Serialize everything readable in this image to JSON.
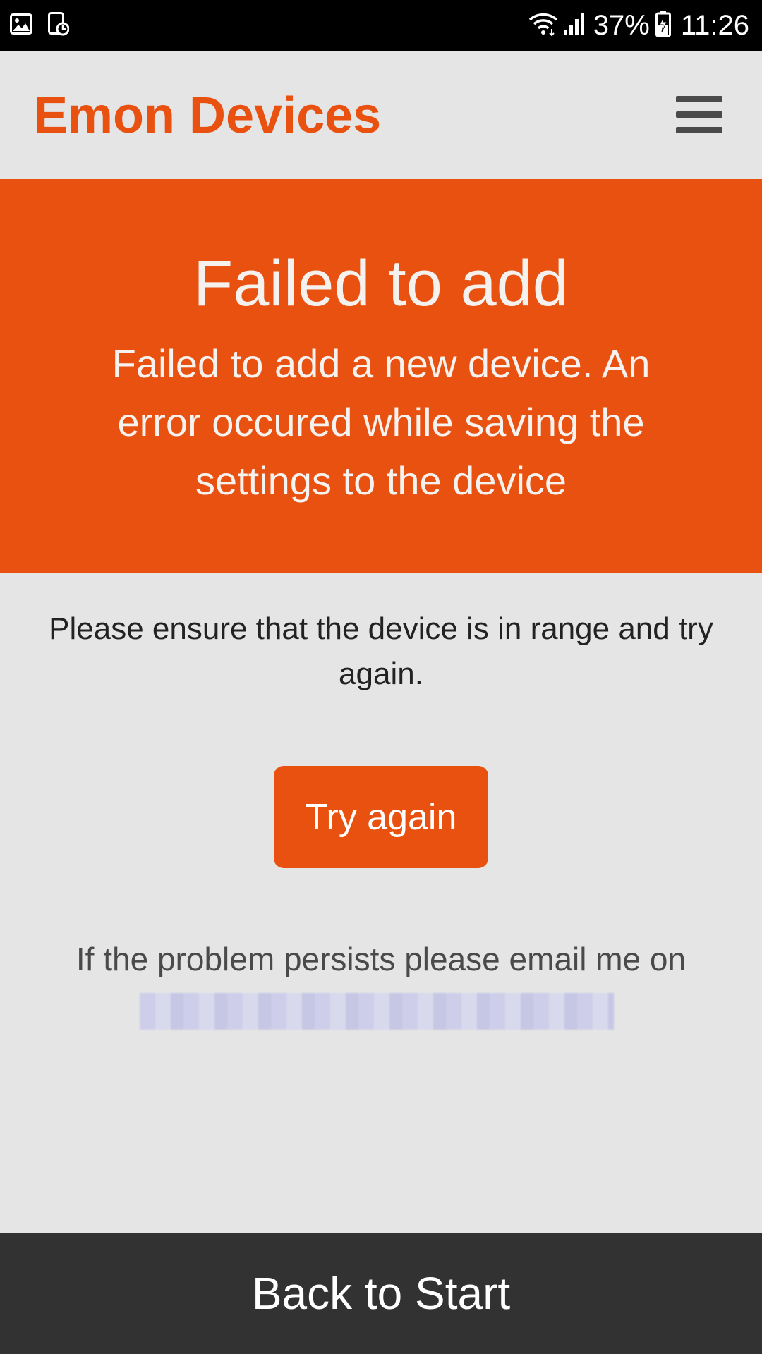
{
  "status_bar": {
    "icons_left": [
      "gallery-icon",
      "screenshot-icon"
    ],
    "icons_right": [
      "wifi-icon",
      "signal-icon",
      "battery-charging-icon"
    ],
    "battery_percent": "37%",
    "time": "11:26"
  },
  "header": {
    "title": "Emon Devices",
    "menu_icon": "hamburger-icon"
  },
  "banner": {
    "heading": "Failed to add",
    "message": "Failed to add a new device. An error occured while saving the settings to the device"
  },
  "body": {
    "instruction": "Please ensure that the device is in range and try again.",
    "try_again_label": "Try again",
    "persist_text": "If the problem persists please email me on"
  },
  "footer": {
    "back_label": "Back to Start"
  },
  "colors": {
    "accent": "#e8510f",
    "background": "#e5e5e5",
    "footer": "#323232",
    "status_bar": "#000000"
  }
}
